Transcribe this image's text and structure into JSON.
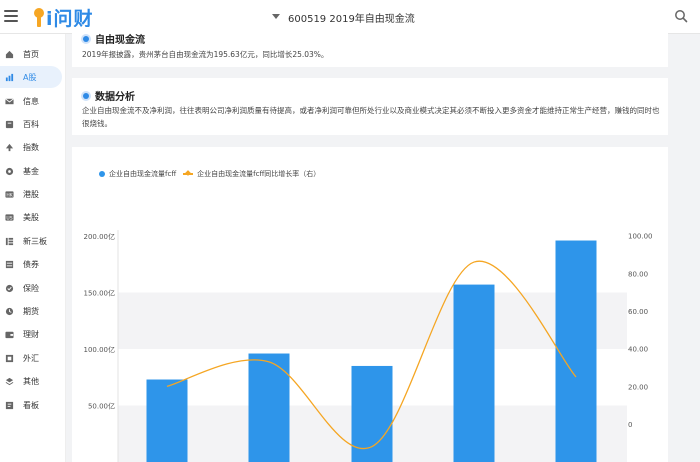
{
  "header": {
    "logo_text": "i问财",
    "search_text": "600519   2019年自由现金流"
  },
  "sidebar": {
    "items": [
      {
        "label": "首页",
        "icon": "home-icon"
      },
      {
        "label": "A股",
        "icon": "chart-icon",
        "active": true
      },
      {
        "label": "信息",
        "icon": "mail-icon"
      },
      {
        "label": "百科",
        "icon": "book-icon"
      },
      {
        "label": "指数",
        "icon": "index-icon"
      },
      {
        "label": "基金",
        "icon": "fund-icon"
      },
      {
        "label": "港股",
        "icon": "hk-icon"
      },
      {
        "label": "美股",
        "icon": "us-icon"
      },
      {
        "label": "新三板",
        "icon": "neeq-icon"
      },
      {
        "label": "债券",
        "icon": "bond-icon"
      },
      {
        "label": "保险",
        "icon": "insurance-icon"
      },
      {
        "label": "期货",
        "icon": "futures-icon"
      },
      {
        "label": "理财",
        "icon": "wallet-icon"
      },
      {
        "label": "外汇",
        "icon": "forex-icon"
      },
      {
        "label": "其他",
        "icon": "layers-icon"
      },
      {
        "label": "看板",
        "icon": "board-icon"
      }
    ]
  },
  "sections": {
    "fcf": {
      "title": "自由现金流",
      "text": "2019年报披露，贵州茅台自由现金流为195.63亿元，同比增长25.03%。"
    },
    "analysis": {
      "title": "数据分析",
      "text": "企业自由现金流不及净利润，往往表明公司净利润质量有待提高，或者净利润可靠但所处行业以及商业模式决定其必须不断投入更多资金才能维持正常生产经营，赚钱的同时也很烧钱。"
    }
  },
  "colors": {
    "accent": "#2e8ae6",
    "bar": "#2e95ea",
    "line": "#f5a623",
    "band": "#f3f3f5"
  },
  "chart_data": {
    "type": "bar",
    "series": [
      {
        "name": "企业自由现金流量fcff",
        "type": "bar",
        "axis": "left",
        "values": [
          73,
          96,
          85,
          157,
          196
        ]
      },
      {
        "name": "企业自由现金流量fcff同比增长率（右）",
        "type": "line",
        "axis": "right",
        "values": [
          20,
          33,
          -12,
          86,
          25
        ]
      }
    ],
    "left_axis": {
      "ticks": [
        "50.00亿",
        "100.00亿",
        "150.00亿",
        "200.00亿"
      ],
      "visible_range": [
        0,
        200
      ]
    },
    "right_axis": {
      "ticks": [
        "0",
        "20.00",
        "40.00",
        "60.00",
        "80.00",
        "100.00"
      ],
      "visible_range": [
        -20,
        100
      ]
    },
    "grid": "alternating horizontal bands"
  }
}
